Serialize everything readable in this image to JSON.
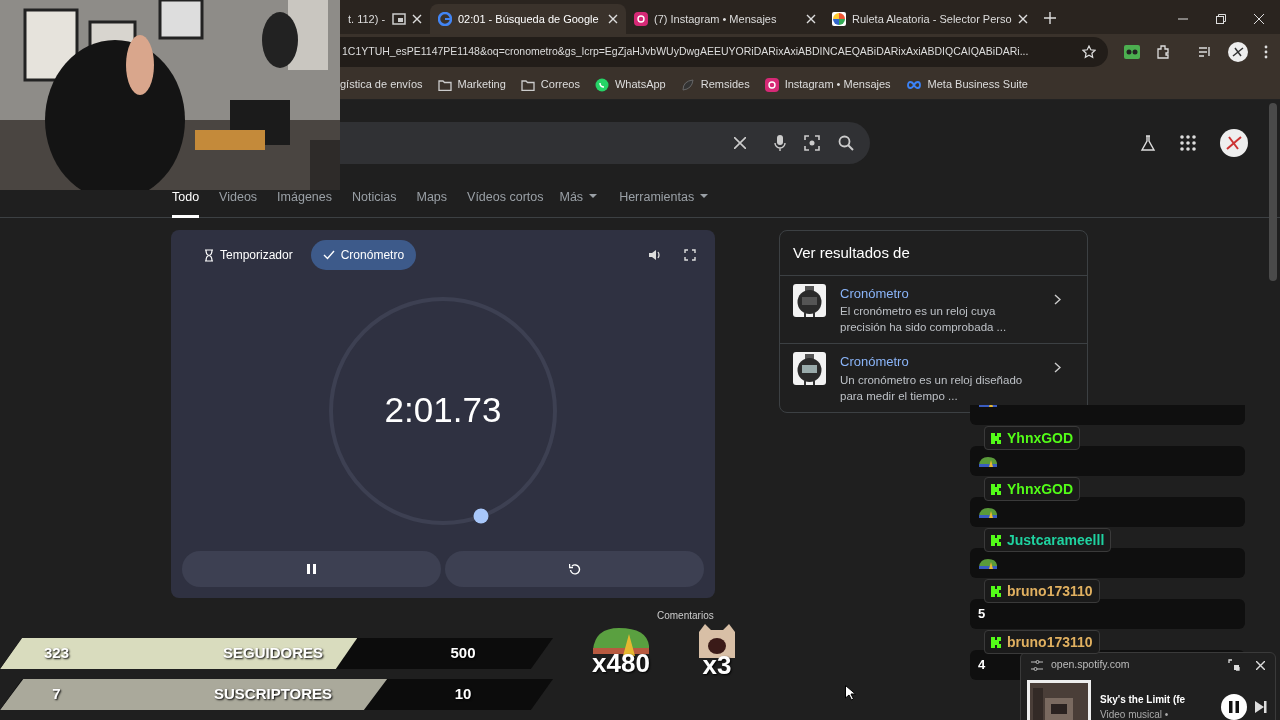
{
  "browser": {
    "tabs": [
      {
        "title": "t. 112) -",
        "kind": "pip",
        "selected": false
      },
      {
        "title": "02:01 - Búsqueda de Google",
        "kind": "google",
        "selected": true
      },
      {
        "title": "(7) Instagram • Mensajes",
        "kind": "instagram",
        "selected": false
      },
      {
        "title": "Ruleta Aleatoria - Selector Perso",
        "kind": "wheel",
        "selected": false
      }
    ],
    "address": "1C1YTUH_esPE1147PE1148&oq=cronometro&gs_lcrp=EgZjaHJvbWUyDwgAEEUYORiDARixAxiABDINCAEQABiDARixAxiABDIQCAIQABiDARi...",
    "bookmarks": [
      {
        "label": "gística de envíos"
      },
      {
        "label": "Marketing",
        "kind": "folder"
      },
      {
        "label": "Correos",
        "kind": "folder"
      },
      {
        "label": "WhatsApp",
        "kind": "whatsapp"
      },
      {
        "label": "Remsides",
        "kind": "leaf"
      },
      {
        "label": "Instagram • Mensajes",
        "kind": "instagram"
      },
      {
        "label": "Meta Business Suite",
        "kind": "meta"
      }
    ]
  },
  "search_tabs": [
    {
      "label": "Todo",
      "selected": true,
      "dropdown": false
    },
    {
      "label": "Videos",
      "selected": false,
      "dropdown": false
    },
    {
      "label": "Imágenes",
      "selected": false,
      "dropdown": false
    },
    {
      "label": "Noticias",
      "selected": false,
      "dropdown": false
    },
    {
      "label": "Maps",
      "selected": false,
      "dropdown": false
    },
    {
      "label": "Vídeos cortos",
      "selected": false,
      "dropdown": false
    },
    {
      "label": "Más",
      "selected": false,
      "dropdown": true
    },
    {
      "label": "Herramientas",
      "selected": false,
      "dropdown": true
    }
  ],
  "stopwatch": {
    "modes": [
      {
        "label": "Temporizador",
        "selected": false
      },
      {
        "label": "Cronómetro",
        "selected": true
      }
    ],
    "time": "2:01.73",
    "running": true
  },
  "results_panel": {
    "title": "Ver resultados de",
    "items": [
      {
        "title": "Cronómetro",
        "snippet": "El cronómetro es un reloj cuya precisión ha sido comprobada ..."
      },
      {
        "title": "Cronómetro",
        "snippet": "Un cronómetro es un reloj diseñado para medir el tiempo ..."
      }
    ]
  },
  "chat": [
    {
      "kind": "emote"
    },
    {
      "user": "YhnxGOD",
      "color": "#53fc18",
      "kind": "emote"
    },
    {
      "user": "YhnxGOD",
      "color": "#53fc18",
      "kind": "emote"
    },
    {
      "user": "Justcarameelll",
      "color": "#1fd2a0",
      "kind": "emote"
    },
    {
      "user": "bruno173110",
      "color": "#e0b060",
      "kind": "text",
      "text": "5"
    },
    {
      "user": "bruno173110",
      "color": "#e0b060",
      "kind": "text",
      "text": "4"
    }
  ],
  "goals": [
    {
      "current": "323",
      "label": "SEGUIDORES",
      "target": "500",
      "level": 0.646,
      "color": "#d9dcbe"
    },
    {
      "current": "7",
      "label": "SUSCRIPTORES",
      "target": "10",
      "level": 0.7,
      "color": "#aaa99b"
    }
  ],
  "comments_label": "Comentarios",
  "emote_counters": [
    {
      "kind": "frog",
      "count": "x480"
    },
    {
      "kind": "cat",
      "count": "x3"
    }
  ],
  "spotify": {
    "site": "open.spotify.com",
    "title": "Sky's the Limit (fe",
    "subtitle": "Video musical •"
  }
}
